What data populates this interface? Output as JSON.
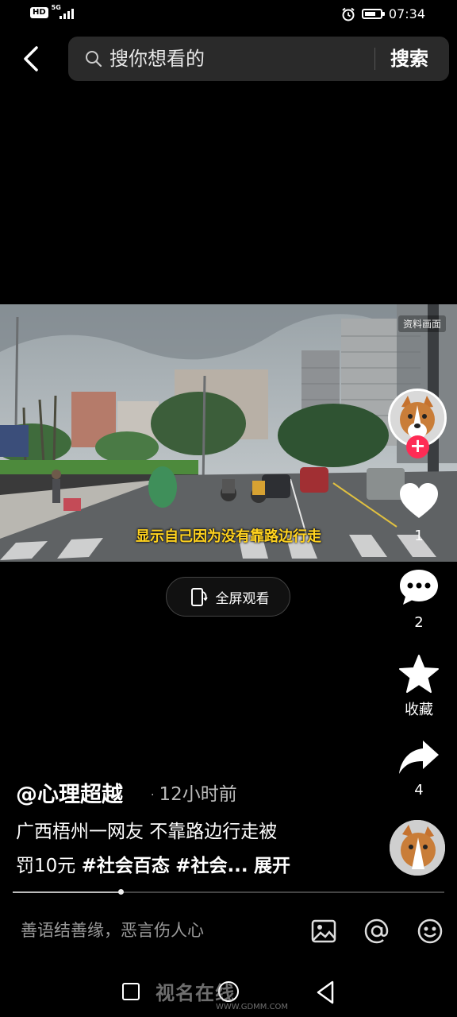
{
  "status_bar": {
    "hd": "HD",
    "network": "5G",
    "time": "07:34",
    "icons": [
      "alarm-icon",
      "battery-icon"
    ]
  },
  "header": {
    "search_placeholder": "搜你想看的",
    "search_button": "搜索"
  },
  "video": {
    "corner_tag": "资料画面",
    "subtitle": "显示自己因为没有靠路边行走",
    "fullscreen_label": "全屏观看"
  },
  "rail": {
    "likes": "1",
    "comments": "2",
    "favorite_label": "收藏",
    "shares": "4"
  },
  "post": {
    "author": "@心理超越",
    "time_sep": "·",
    "time": "12小时前",
    "desc_line1": "广西梧州一网友 不靠路边行走被",
    "desc_line2_prefix": "罚10元 ",
    "tag1": "#社会百态",
    "tag2": "#社会...",
    "expand": "展开"
  },
  "progress": {
    "fraction": 0.25
  },
  "comment_bar": {
    "placeholder": "善语结善缘，恶言伤人心",
    "icons": [
      "image-icon",
      "at-icon",
      "emoji-icon"
    ]
  },
  "watermark": {
    "text": "视名在线",
    "url": "WWW.GDMM.COM"
  },
  "colors": {
    "accent": "#fe2c55",
    "subtitle": "#ffd21f",
    "background": "#000000"
  }
}
